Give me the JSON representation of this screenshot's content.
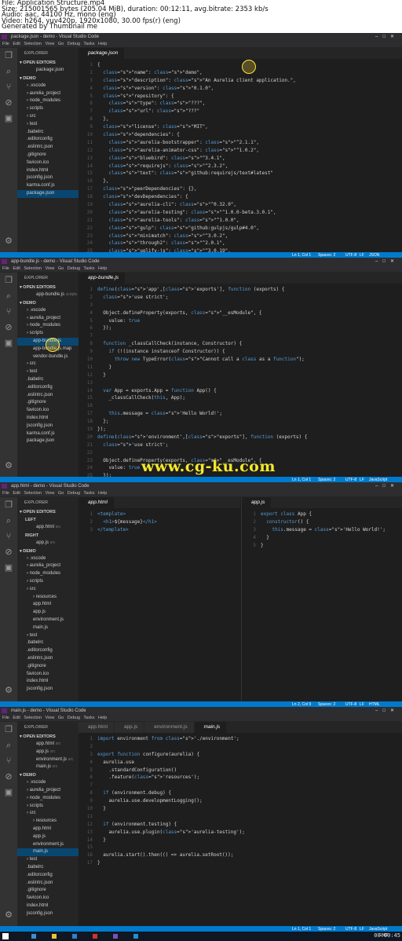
{
  "header": {
    "lines": [
      "File: Application Structure.mp4",
      "Size: 215001565 bytes (205.04 MiB), duration: 00:12:11, avg.bitrate: 2353 kb/s",
      "Audio: aac, 44100 Hz, mono (eng)",
      "Video: h264, yuv420p, 1920x1080, 30.00 fps(r) (eng)",
      "Generated by Thumbnail me"
    ]
  },
  "watermark": "www.cg-ku.com",
  "menu": "File  Edit  Selection  View  Go  Debug  Tasks  Help",
  "frames": [
    {
      "title": "package.json - demo - Visual Studio Code",
      "explorer": "EXPLORER",
      "open_editors": "OPEN EDITORS",
      "open_files": [
        {
          "name": "package.json",
          "sel": false
        }
      ],
      "project": "DEMO",
      "tree": [
        [
          "› .vscode",
          1
        ],
        [
          "› aurelia_project",
          1
        ],
        [
          "› node_modules",
          1
        ],
        [
          "› scripts",
          1
        ],
        [
          "› src",
          1
        ],
        [
          "› test",
          1
        ],
        [
          ".babelrc",
          1
        ],
        [
          ".editorconfig",
          1
        ],
        [
          ".eslintrc.json",
          1
        ],
        [
          ".gitignore",
          1
        ],
        [
          "favicon.ico",
          1
        ],
        [
          "index.html",
          1
        ],
        [
          "jsconfig.json",
          1
        ],
        [
          "karma.conf.js",
          1
        ],
        [
          "package.json",
          1
        ]
      ],
      "selected": "package.json",
      "tab": "package.json",
      "code": [
        "{",
        "  \"name\": \"demo\",",
        "  \"description\": \"An Aurelia client application.\",",
        "  \"version\": \"0.1.0\",",
        "  \"repository\": {",
        "    \"type\": \"???\",",
        "    \"url\": \"???\"",
        "  },",
        "  \"license\": \"MIT\",",
        "  \"dependencies\": {",
        "    \"aurelia-bootstrapper\": \"^2.1.1\",",
        "    \"aurelia-animator-css\": \"^1.0.2\",",
        "    \"bluebird\": \"^3.4.1\",",
        "    \"requirejs\": \"^2.3.2\",",
        "    \"text\": \"github:requirejs/text#latest\"",
        "  },",
        "  \"peerDependencies\": {},",
        "  \"devDependencies\": {",
        "    \"aurelia-cli\": \"^0.32.0\",",
        "    \"aurelia-testing\": \"^1.0.0-beta.3.0.1\",",
        "    \"aurelia-tools\": \"^1.0.0\",",
        "    \"gulp\": \"github:gulpjs/gulp#4.0\",",
        "    \"minimatch\": \"^3.0.2\",",
        "    \"through2\": \"^2.0.1\",",
        "    \"uglify-js\": \"^3.0.19\",",
        "    \"vinyl-fs\": \"^2.4.3\",",
        "    \"babel-eslint\": \"^6.0.4\""
      ],
      "status": [
        "Ln 1, Col 1",
        "Spaces: 2",
        "UTF-8",
        "LF",
        "JSON"
      ],
      "time": "00:02:27"
    },
    {
      "title": "app-bundle.js - demo - Visual Studio Code",
      "open_files": [
        {
          "name": "app-bundle.js",
          "suffix": "scripts"
        }
      ],
      "tree": [
        [
          "› .vscode",
          1
        ],
        [
          "› aurelia_project",
          1
        ],
        [
          "› node_modules",
          1
        ],
        [
          "› scripts",
          1
        ],
        [
          "app-bundle.js",
          2
        ],
        [
          "app-bundle.js.map",
          2
        ],
        [
          "vendor-bundle.js",
          2
        ],
        [
          "› src",
          1
        ],
        [
          "› test",
          1
        ],
        [
          ".babelrc",
          1
        ],
        [
          ".editorconfig",
          1
        ],
        [
          ".eslintrc.json",
          1
        ],
        [
          ".gitignore",
          1
        ],
        [
          "favicon.ico",
          1
        ],
        [
          "index.html",
          1
        ],
        [
          "jsconfig.json",
          1
        ],
        [
          "karma.conf.js",
          1
        ],
        [
          "package.json",
          1
        ]
      ],
      "selected": "app-bundle.js",
      "tab": "app-bundle.js",
      "code": [
        "define('app',['exports'], function (exports) {",
        "  'use strict';",
        "",
        "  Object.defineProperty(exports, \"__esModule\", {",
        "    value: true",
        "  });",
        "",
        "  function _classCallCheck(instance, Constructor) {",
        "    if (!(instance instanceof Constructor)) {",
        "      throw new TypeError(\"Cannot call a class as a function\");",
        "    }",
        "  }",
        "",
        "  var App = exports.App = function App() {",
        "    _classCallCheck(this, App);",
        "",
        "    this.message = 'Hello World!';",
        "  };",
        "});",
        "define('environment',[\"exports\"], function (exports) {",
        "  'use strict';",
        "",
        "  Object.defineProperty(exports, \"__esModule\", {",
        "    value: true",
        "  });",
        "  exports.default = {",
        "    debug: true,"
      ],
      "status": [
        "Ln 1, Col 1",
        "Spaces: 2",
        "UTF-8",
        "LF",
        "JavaScript"
      ],
      "time": "00:04:53"
    },
    {
      "title": "app.html - demo - Visual Studio Code",
      "left": "LEFT",
      "right": "RIGHT",
      "open_left": [
        {
          "name": "app.html",
          "suffix": "src"
        }
      ],
      "open_right": [
        {
          "name": "app.js",
          "suffix": "src"
        }
      ],
      "tree": [
        [
          "› .vscode",
          1
        ],
        [
          "› aurelia_project",
          1
        ],
        [
          "› node_modules",
          1
        ],
        [
          "› scripts",
          1
        ],
        [
          "› src",
          1
        ],
        [
          "› resources",
          2
        ],
        [
          "app.html",
          2
        ],
        [
          "app.js",
          2
        ],
        [
          "environment.js",
          2
        ],
        [
          "main.js",
          2
        ],
        [
          "› test",
          1
        ],
        [
          ".babelrc",
          1
        ],
        [
          ".editorconfig",
          1
        ],
        [
          ".eslintrc.json",
          1
        ],
        [
          ".gitignore",
          1
        ],
        [
          "favicon.ico",
          1
        ],
        [
          "index.html",
          1
        ],
        [
          "jsconfig.json",
          1
        ]
      ],
      "tab_left": "app.html",
      "tab_right": "app.js",
      "code_left": [
        "<template>",
        "  <h1>${message}</h1>",
        "</template>"
      ],
      "code_right": [
        "export class App {",
        "  constructor() {",
        "    this.message = 'Hello World!';",
        "  }",
        "}"
      ],
      "status": [
        "Ln 2, Col 9",
        "Spaces: 2",
        "UTF-8",
        "LF",
        "HTML"
      ],
      "time": "00:07:20"
    },
    {
      "title": "main.js - demo - Visual Studio Code",
      "open_files": [
        {
          "name": "app.html",
          "suffix": "src"
        },
        {
          "name": "app.js",
          "suffix": "src"
        },
        {
          "name": "environment.js",
          "suffix": "src"
        },
        {
          "name": "main.js",
          "suffix": "src"
        }
      ],
      "tree": [
        [
          "› .vscode",
          1
        ],
        [
          "› aurelia_project",
          1
        ],
        [
          "› node_modules",
          1
        ],
        [
          "› scripts",
          1
        ],
        [
          "› src",
          1
        ],
        [
          "› resources",
          2
        ],
        [
          "app.html",
          2
        ],
        [
          "app.js",
          2
        ],
        [
          "environment.js",
          2
        ],
        [
          "main.js",
          2
        ],
        [
          "› test",
          1
        ],
        [
          ".babelrc",
          1
        ],
        [
          ".editorconfig",
          1
        ],
        [
          ".eslintrc.json",
          1
        ],
        [
          ".gitignore",
          1
        ],
        [
          "favicon.ico",
          1
        ],
        [
          "index.html",
          1
        ],
        [
          "jsconfig.json",
          1
        ]
      ],
      "selected": "main.js",
      "tabs": [
        "app.html",
        "app.js",
        "environment.js",
        "main.js"
      ],
      "code": [
        "import environment from './environment';",
        "",
        "export function configure(aurelia) {",
        "  aurelia.use",
        "    .standardConfiguration()",
        "    .feature('resources');",
        "",
        "  if (environment.debug) {",
        "    aurelia.use.developmentLogging();",
        "  }",
        "",
        "  if (environment.testing) {",
        "    aurelia.use.plugin('aurelia-testing');",
        "  }",
        "",
        "  aurelia.start().then(() => aurelia.setRoot());",
        "}"
      ],
      "status": [
        "Ln 1, Col 1",
        "Spaces: 2",
        "UTF-8",
        "LF",
        "JavaScript"
      ],
      "time": "00:09:45"
    }
  ],
  "tray": {
    "clock": "12:16",
    "lang": "ENG"
  }
}
